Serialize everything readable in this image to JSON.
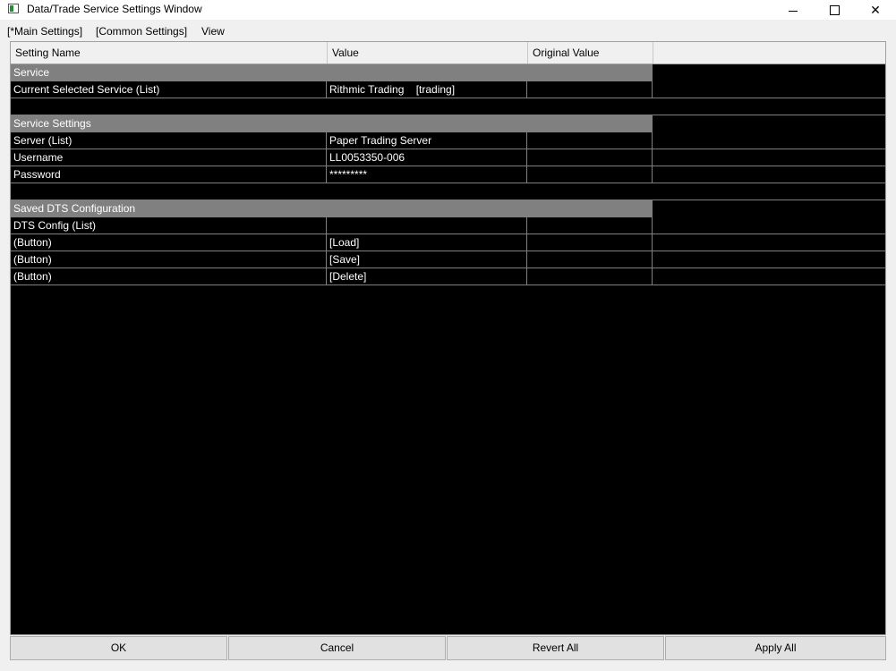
{
  "window": {
    "title": "Data/Trade Service Settings Window",
    "icon": "app-window-icon",
    "controls": [
      "minimize-icon",
      "maximize-icon",
      "close-icon"
    ]
  },
  "menu": {
    "main_settings": "[*Main Settings]",
    "common_settings": "[Common Settings]",
    "view": "View"
  },
  "grid": {
    "columns": {
      "name": "Setting Name",
      "value": "Value",
      "original": "Original Value",
      "extra": ""
    },
    "sections": {
      "service": "Service",
      "service_settings": "Service Settings",
      "saved_dts": "Saved DTS Configuration"
    },
    "rows": {
      "current_service": {
        "name": "Current Selected Service (List)",
        "value": "Rithmic Trading    [trading]"
      },
      "server": {
        "name": "Server (List)",
        "value": "Paper Trading Server"
      },
      "username": {
        "name": "Username",
        "value": "LL0053350-006"
      },
      "password": {
        "name": "Password",
        "value": "*********"
      },
      "dts_config": {
        "name": "DTS Config (List)",
        "value": ""
      },
      "load": {
        "name": "(Button)",
        "value": "[Load]"
      },
      "save": {
        "name": "(Button)",
        "value": "[Save]"
      },
      "delete": {
        "name": "(Button)",
        "value": "[Delete]"
      }
    }
  },
  "buttons": {
    "ok": "OK",
    "cancel": "Cancel",
    "revert_all": "Revert All",
    "apply_all": "Apply All"
  },
  "colors": {
    "grid_background": "#000000",
    "section_header": "#808080",
    "cell_text": "#ffffff",
    "chrome": "#f0f0f0"
  }
}
